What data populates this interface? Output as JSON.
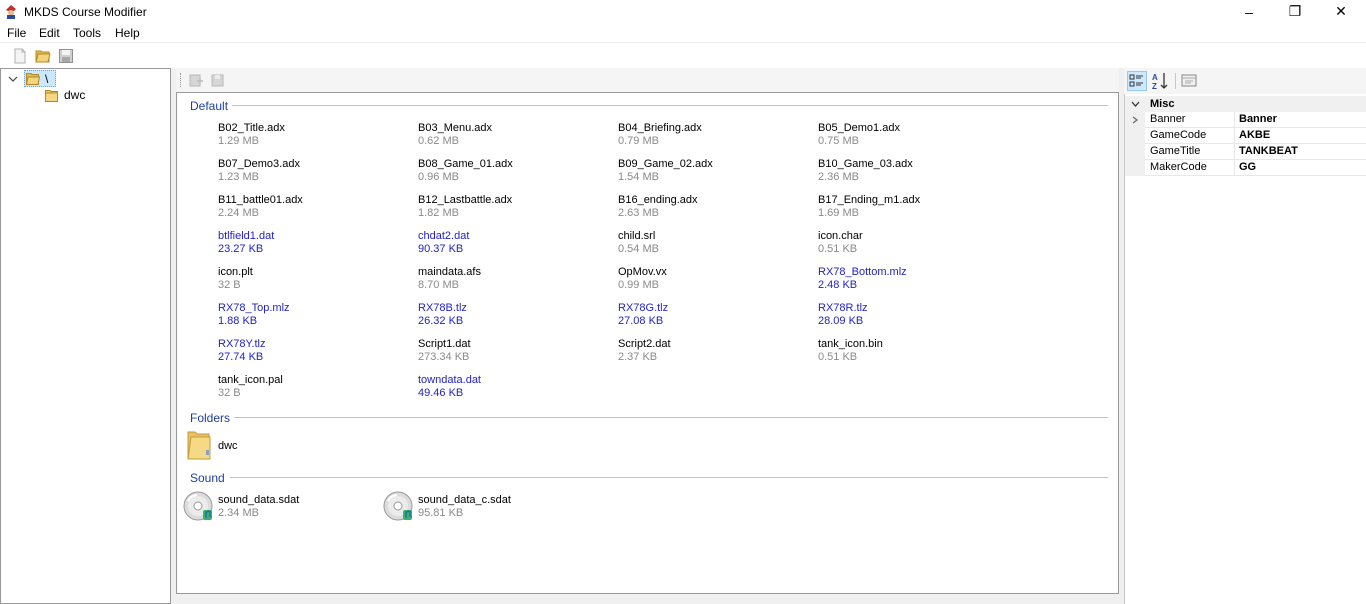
{
  "window": {
    "title": "MKDS Course Modifier",
    "minimize_glyph": "–",
    "maximize_glyph": "❐",
    "close_glyph": "✕"
  },
  "menu": [
    "File",
    "Edit",
    "Tools",
    "Help"
  ],
  "toolbar": {
    "icons": [
      "new-file-icon",
      "open-folder-icon",
      "save-icon"
    ]
  },
  "tree": {
    "root_label": "\\",
    "children": [
      "dwc"
    ]
  },
  "groups": {
    "default": "Default",
    "folders": "Folders",
    "sound": "Sound"
  },
  "files": [
    {
      "name": "B02_Title.adx",
      "size": "1.29 MB",
      "highlight": false
    },
    {
      "name": "B03_Menu.adx",
      "size": "0.62 MB",
      "highlight": false
    },
    {
      "name": "B04_Briefing.adx",
      "size": "0.79 MB",
      "highlight": false
    },
    {
      "name": "B05_Demo1.adx",
      "size": "0.75 MB",
      "highlight": false
    },
    {
      "name": "B07_Demo3.adx",
      "size": "1.23 MB",
      "highlight": false
    },
    {
      "name": "B08_Game_01.adx",
      "size": "0.96 MB",
      "highlight": false
    },
    {
      "name": "B09_Game_02.adx",
      "size": "1.54 MB",
      "highlight": false
    },
    {
      "name": "B10_Game_03.adx",
      "size": "2.36 MB",
      "highlight": false
    },
    {
      "name": "B11_battle01.adx",
      "size": "2.24 MB",
      "highlight": false
    },
    {
      "name": "B12_Lastbattle.adx",
      "size": "1.82 MB",
      "highlight": false
    },
    {
      "name": "B16_ending.adx",
      "size": "2.63 MB",
      "highlight": false
    },
    {
      "name": "B17_Ending_m1.adx",
      "size": "1.69 MB",
      "highlight": false
    },
    {
      "name": "btlfield1.dat",
      "size": "23.27 KB",
      "highlight": true
    },
    {
      "name": "chdat2.dat",
      "size": "90.37 KB",
      "highlight": true
    },
    {
      "name": "child.srl",
      "size": "0.54 MB",
      "highlight": false
    },
    {
      "name": "icon.char",
      "size": "0.51 KB",
      "highlight": false
    },
    {
      "name": "icon.plt",
      "size": "32 B",
      "highlight": false
    },
    {
      "name": "maindata.afs",
      "size": "8.70 MB",
      "highlight": false
    },
    {
      "name": "OpMov.vx",
      "size": "0.99 MB",
      "highlight": false
    },
    {
      "name": "RX78_Bottom.mlz",
      "size": "2.48 KB",
      "highlight": true
    },
    {
      "name": "RX78_Top.mlz",
      "size": "1.88 KB",
      "highlight": true
    },
    {
      "name": "RX78B.tlz",
      "size": "26.32 KB",
      "highlight": true
    },
    {
      "name": "RX78G.tlz",
      "size": "27.08 KB",
      "highlight": true
    },
    {
      "name": "RX78R.tlz",
      "size": "28.09 KB",
      "highlight": true
    },
    {
      "name": "RX78Y.tlz",
      "size": "27.74 KB",
      "highlight": true
    },
    {
      "name": "Script1.dat",
      "size": "273.34 KB",
      "highlight": false
    },
    {
      "name": "Script2.dat",
      "size": "2.37 KB",
      "highlight": false
    },
    {
      "name": "tank_icon.bin",
      "size": "0.51 KB",
      "highlight": false
    },
    {
      "name": "tank_icon.pal",
      "size": "32 B",
      "highlight": false
    },
    {
      "name": "towndata.dat",
      "size": "49.46 KB",
      "highlight": true
    }
  ],
  "folders": [
    "dwc"
  ],
  "sounds": [
    {
      "name": "sound_data.sdat",
      "size": "2.34 MB"
    },
    {
      "name": "sound_data_c.sdat",
      "size": "95.81 KB"
    }
  ],
  "properties": {
    "category": "Misc",
    "rows": [
      {
        "name": "Banner",
        "value": "Banner",
        "expandable": true
      },
      {
        "name": "GameCode",
        "value": "AKBE",
        "expandable": false
      },
      {
        "name": "GameTitle",
        "value": "TANKBEAT",
        "expandable": false
      },
      {
        "name": "MakerCode",
        "value": "GG",
        "expandable": false
      }
    ]
  },
  "colors": {
    "highlight_text": "#2222cc",
    "size_text": "#8a8a8a",
    "group_header": "#1e3fa0",
    "selection": "#cce8ff"
  }
}
